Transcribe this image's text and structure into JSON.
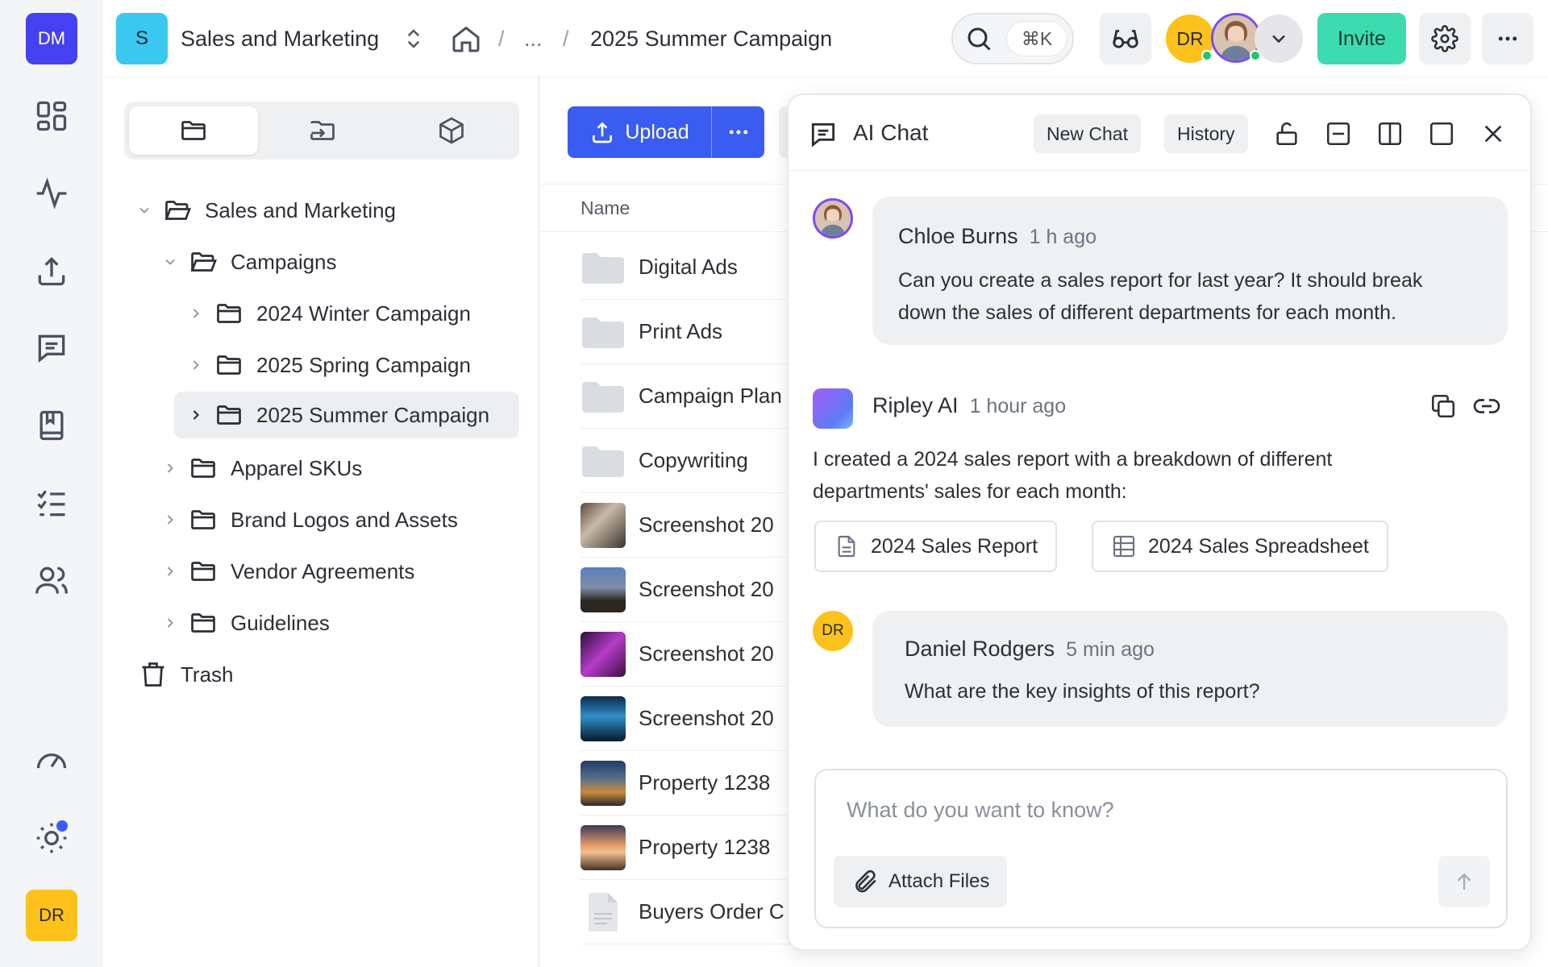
{
  "rail": {
    "workspace_initials": "DM",
    "user_initials": "DR",
    "icons": [
      "dashboard-icon",
      "activity-icon",
      "upload-icon",
      "comments-icon",
      "book-icon",
      "checklist-icon",
      "users-icon",
      "gauge-icon",
      "sun-icon"
    ]
  },
  "topbar": {
    "workspace_badge": "S",
    "workspace_name": "Sales and Marketing",
    "breadcrumb": {
      "sep": "/",
      "ellipsis": "...",
      "current": "2025 Summer Campaign"
    },
    "search_shortcut": "⌘K",
    "avatar_initials": "DR",
    "invite_label": "Invite"
  },
  "tree": {
    "root": "Sales and Marketing",
    "campaigns": "Campaigns",
    "items": [
      "2024 Winter Campaign",
      "2025 Spring Campaign",
      "2025 Summer Campaign"
    ],
    "siblings": [
      "Apparel SKUs",
      "Brand Logos and Assets",
      "Vendor Agreements",
      "Guidelines"
    ],
    "trash": "Trash"
  },
  "files": {
    "upload_label": "Upload",
    "column_name": "Name",
    "rows": [
      "Digital Ads",
      "Print Ads",
      "Campaign Plan",
      "Copywriting",
      "Screenshot 20",
      "Screenshot 20",
      "Screenshot 20",
      "Screenshot 20",
      "Property 1238",
      "Property 1238",
      "Buyers Order C"
    ]
  },
  "chat": {
    "title": "AI Chat",
    "new_chat": "New Chat",
    "history": "History",
    "messages": {
      "m1": {
        "author": "Chloe Burns",
        "time": "1 h ago",
        "line1": "Can you create a sales report for last year? It should break",
        "line2": "down the sales of different departments for each month."
      },
      "m2": {
        "author": "Ripley AI",
        "time": "1 hour ago",
        "line1": "I created a 2024 sales report with a breakdown of different",
        "line2": "departments' sales for each month:"
      },
      "m3": {
        "author": "Daniel Rodgers",
        "time": "5 min ago",
        "text": "What are the key insights of this report?",
        "initials": "DR"
      }
    },
    "attachments": [
      "2024 Sales Report",
      "2024 Sales Spreadsheet"
    ],
    "composer": {
      "placeholder": "What do you want to know?",
      "attach_label": "Attach Files"
    }
  },
  "colors": {
    "accent": "#3b5cf0",
    "invite": "#3ddbb0",
    "workspace": "#4740f0",
    "user": "#fcc21b"
  }
}
